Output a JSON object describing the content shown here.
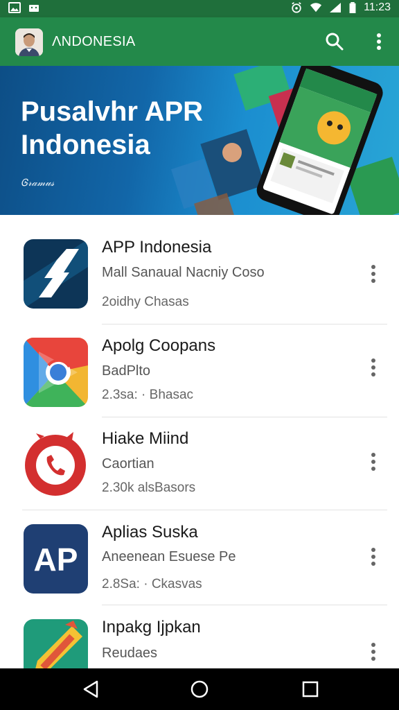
{
  "status_bar": {
    "time": "11:23",
    "left_icons": [
      "image-icon",
      "android-icon"
    ],
    "right_icons": [
      "alarm-icon",
      "wifi-icon",
      "signal-icon",
      "battery-icon"
    ]
  },
  "app_bar": {
    "title": "ΛNDONESIA",
    "icons": [
      "avatar",
      "search-icon",
      "more-vert-icon"
    ]
  },
  "banner": {
    "title_line1": "Pusalvhr APR",
    "title_line2": "Indonesia",
    "signature": "Ꮆ𝓇𝒶𝓂𝓊𝓈"
  },
  "apps": [
    {
      "name": "APP Indonesia",
      "subtitle": "Mall Sanaual Nacniy Coso",
      "meta": "2oidhy Chasas",
      "icon": "stylized-s-icon"
    },
    {
      "name": "Apolg Coopans",
      "subtitle": "BadPlto",
      "meta": "2.3sa: · Bhasac",
      "icon": "chrome-play-icon"
    },
    {
      "name": "Hiake Miind",
      "subtitle": "Caortian",
      "meta": "2.30k alsBasors",
      "icon": "phone-badge-icon"
    },
    {
      "name": "Aplias Suska",
      "subtitle": "Aneenean Esuese Pe",
      "meta": "2.8Sa: · Ckasvas",
      "icon": "ap-logo-icon",
      "icon_text": "AP"
    },
    {
      "name": "Inpakg Ijpkan",
      "subtitle": "Reudaes",
      "meta": "",
      "icon": "pen-icon"
    }
  ],
  "colors": {
    "status_bar": "#1f6f3b",
    "app_bar": "#23894a",
    "banner": "#1266a8",
    "nav_bar": "#000000"
  },
  "nav_bar": {
    "icons": [
      "back-icon",
      "home-icon",
      "recents-icon"
    ]
  }
}
